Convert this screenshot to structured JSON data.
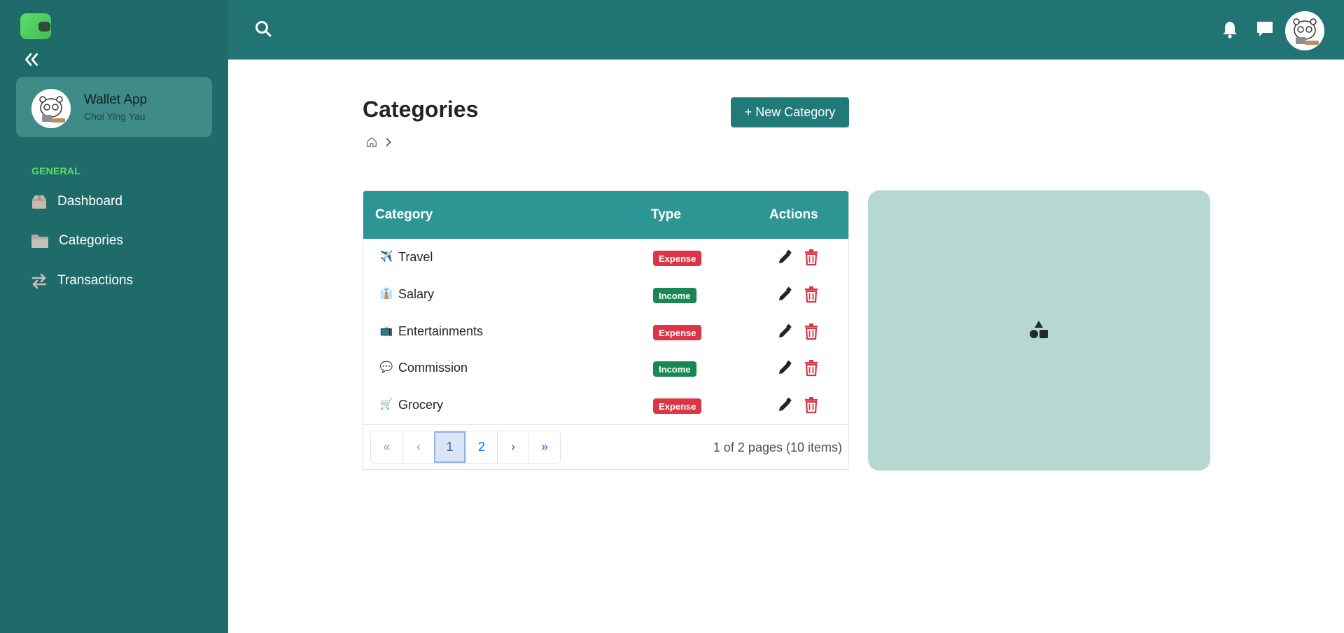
{
  "sidebar": {
    "app_name": "Wallet App",
    "user_name": "Choi Ying Yau",
    "section_label": "GENERAL",
    "items": [
      {
        "label": "Dashboard",
        "icon": "box-icon"
      },
      {
        "label": "Categories",
        "icon": "folder-icon"
      },
      {
        "label": "Transactions",
        "icon": "arrows-swap-icon"
      }
    ]
  },
  "topbar": {
    "icons": [
      "search-icon",
      "bell-icon",
      "chat-icon",
      "avatar"
    ]
  },
  "main": {
    "title": "Categories",
    "new_button_label": "+ New Category",
    "table": {
      "headers": {
        "category": "Category",
        "type": "Type",
        "actions": "Actions"
      },
      "rows": [
        {
          "icon": "✈️",
          "name": "Travel",
          "type": "Expense"
        },
        {
          "icon": "👔",
          "name": "Salary",
          "type": "Income"
        },
        {
          "icon": "📺",
          "name": "Entertainments",
          "type": "Expense"
        },
        {
          "icon": "💬",
          "name": "Commission",
          "type": "Income"
        },
        {
          "icon": "🛒",
          "name": "Grocery",
          "type": "Expense"
        }
      ]
    },
    "pagination": {
      "first": "«",
      "prev": "‹",
      "pages": [
        "1",
        "2"
      ],
      "next": "›",
      "last": "»",
      "current": "1",
      "info": "1 of 2 pages (10 items)"
    }
  },
  "colors": {
    "sidebar": "#1e6b6a",
    "topbar": "#227373",
    "table_header": "#2e9595",
    "expense": "#dc3545",
    "income": "#198754",
    "accent_green": "#5ee062",
    "preview_panel": "#b7d8d0"
  }
}
